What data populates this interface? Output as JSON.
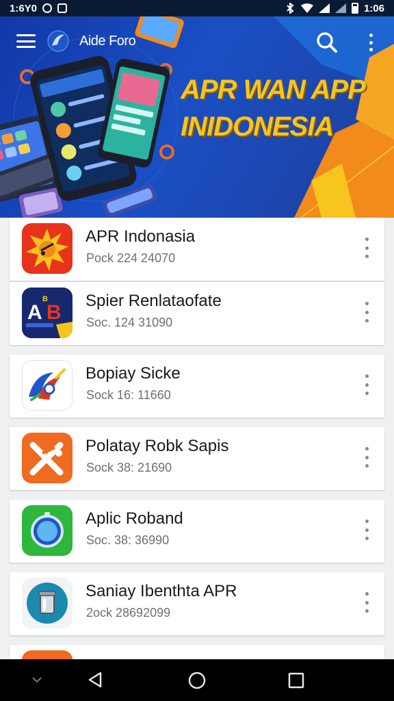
{
  "status_bar": {
    "left_text": "1:6Y0",
    "right_time": "1:06"
  },
  "header": {
    "app_title": "Aide Foro",
    "headline_line1": "APR WAN APP",
    "headline_line2": "INIDONESIA"
  },
  "apps": [
    {
      "name": "APR Indonasia",
      "subtitle": "Pock 224 24070",
      "icon": "sun-star-icon",
      "color": "#e8331c"
    },
    {
      "name": "Spier Renlataofate",
      "subtitle": "Soc. 124 31090",
      "icon": "ab-letters-icon",
      "color": "#1a2f7a"
    },
    {
      "name": "Bopiay Sicke",
      "subtitle": "Sock 16: 11660",
      "icon": "swoosh-logo-icon",
      "color": "#ffffff"
    },
    {
      "name": "Polatay Robk Sapis",
      "subtitle": "Sock 38: 21690",
      "icon": "x-mark-icon",
      "color": "#f06a20"
    },
    {
      "name": "Aplic Roband",
      "subtitle": "Soc. 38: 36990",
      "icon": "compass-icon",
      "color": "#2eb63d"
    },
    {
      "name": "Saniay Ibenthta APR",
      "subtitle": "2ock 28692099",
      "icon": "canister-icon",
      "color": "#f1f3f5"
    }
  ],
  "colors": {
    "banner_blue": "#1a4fc4",
    "accent_orange": "#f28a1c",
    "headline_yellow": "#f7c51e",
    "status_bar": "#0a1a33"
  }
}
